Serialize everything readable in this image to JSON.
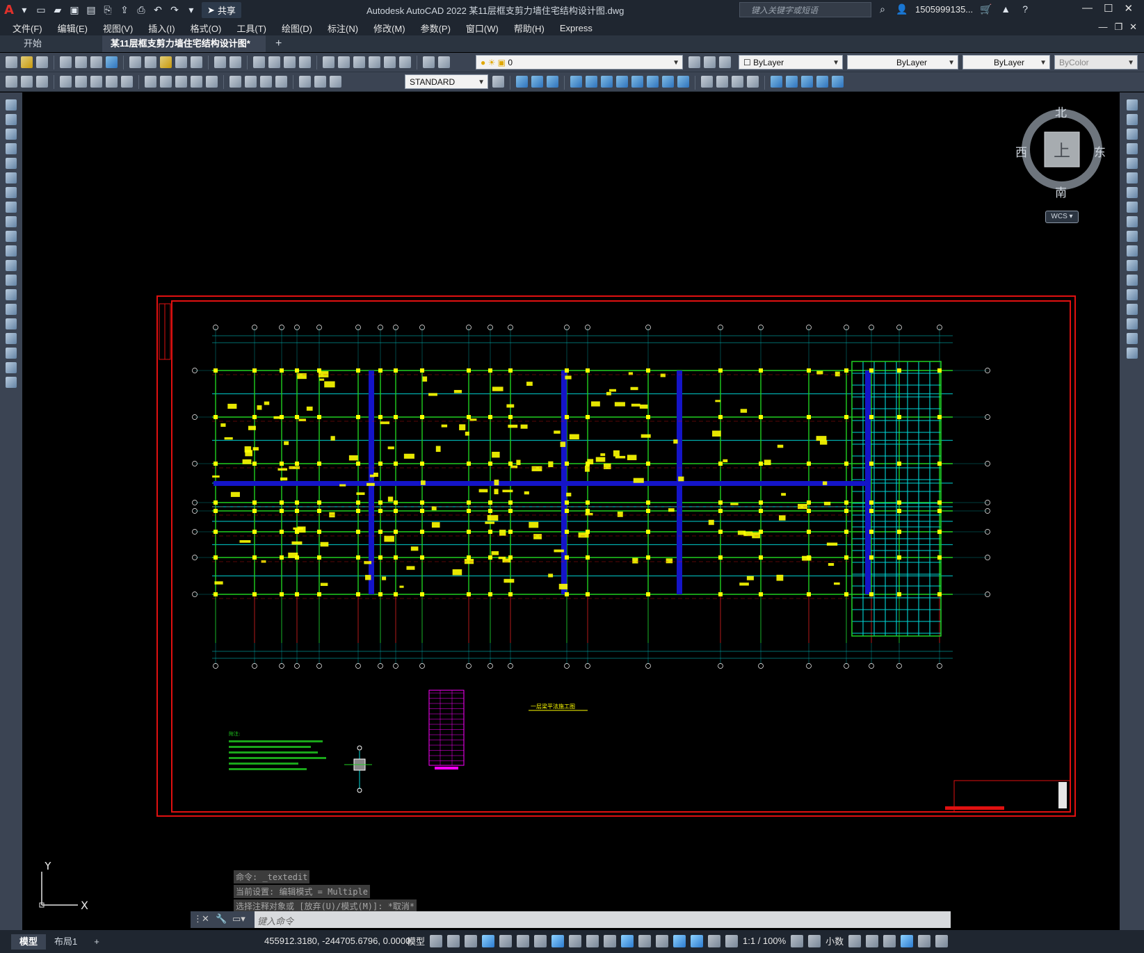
{
  "window": {
    "title": "Autodesk AutoCAD 2022    某11层框支剪力墙住宅结构设计图.dwg",
    "search_placeholder": "键入关键字或短语",
    "user": "1505999135...",
    "share_label": "共享"
  },
  "menu": [
    "文件(F)",
    "编辑(E)",
    "视图(V)",
    "插入(I)",
    "格式(O)",
    "工具(T)",
    "绘图(D)",
    "标注(N)",
    "修改(M)",
    "参数(P)",
    "窗口(W)",
    "帮助(H)",
    "Express"
  ],
  "tabs": {
    "start": "开始",
    "doc": "某11层框支剪力墙住宅结构设计图*",
    "add": "+"
  },
  "properties": {
    "layer": "0",
    "color": "ByLayer",
    "linetype": "ByLayer",
    "lineweight": "ByLayer",
    "plotstyle": "ByColor",
    "textstyle": "STANDARD"
  },
  "viewcube": {
    "top_face": "上",
    "north": "北",
    "south": "南",
    "east": "东",
    "west": "西",
    "wcs": "WCS"
  },
  "drawing": {
    "plan_title": "一层梁平法施工图",
    "notes_heading": "附注:"
  },
  "ucs": {
    "x": "X",
    "y": "Y"
  },
  "command": {
    "history": [
      "命令: _textedit",
      "当前设置: 编辑模式 = Multiple",
      "选择注释对象或 [放弃(U)/模式(M)]: *取消*"
    ],
    "placeholder": "键入命令"
  },
  "status": {
    "layouts": [
      "模型",
      "布局1",
      "+"
    ],
    "coordinates": "455912.3180, -244705.6796, 0.0000",
    "model_label": "模型",
    "scale": "1:1 / 100%",
    "units": "小数"
  },
  "colors": {
    "background": "#000000",
    "frame_red": "#e01010",
    "axis_cyan": "#00d8d8",
    "beam_green": "#20d020",
    "column_yellow": "#ffff00",
    "wall_blue": "#1414c8"
  }
}
